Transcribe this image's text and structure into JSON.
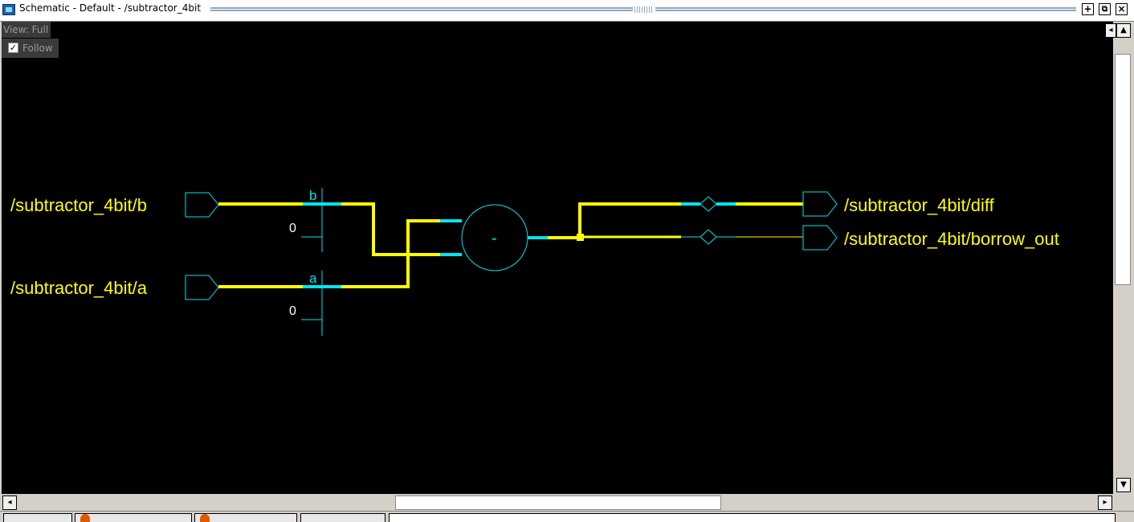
{
  "window": {
    "title": "Schematic - Default  - /subtractor_4bit",
    "buttons": {
      "add": "+",
      "undock": "⧉",
      "close": "×"
    }
  },
  "view": {
    "label": "View: Full",
    "follow_label": "Follow",
    "follow_checked": true
  },
  "schematic": {
    "ports": {
      "in_b": "/subtractor_4bit/b",
      "in_a": "/subtractor_4bit/a",
      "out_diff": "/subtractor_4bit/diff",
      "out_borrow": "/subtractor_4bit/borrow_out"
    },
    "bus_labels": {
      "b": "b",
      "a": "a"
    },
    "constants": {
      "b_zero": "0",
      "a_zero": "0"
    },
    "operator": "-",
    "colors": {
      "net": "#ffff00",
      "component": "#00e5ee",
      "background": "#000000",
      "text": "#ffff00",
      "const_text": "#ffffff"
    }
  },
  "statusbar": {
    "tabs": [
      "",
      "",
      "",
      ""
    ]
  }
}
